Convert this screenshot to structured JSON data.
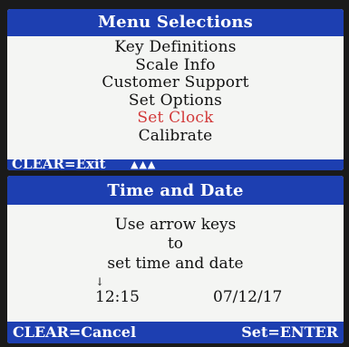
{
  "menu_screen": {
    "title": "Menu Selections",
    "items": [
      {
        "label": "Key Definitions"
      },
      {
        "label": "Scale Info"
      },
      {
        "label": "Customer Support"
      },
      {
        "label": "Set Options"
      },
      {
        "label": "Set Clock",
        "selected": true
      },
      {
        "label": "Calibrate"
      }
    ],
    "selected_color": "#d23a3a",
    "footer_label": "CLEAR=Exit",
    "footer_arrows": "▲▲▲"
  },
  "clock_screen": {
    "title": "Time and Date",
    "instruction_lines": [
      "Use arrow keys",
      "to",
      "set time and date"
    ],
    "cursor_glyph": "↓",
    "time": "12:15",
    "date": "07/12/17",
    "footer_left": "CLEAR=Cancel",
    "footer_right": "Set=ENTER"
  },
  "colors": {
    "bar_blue": "#1d3fb1",
    "screen_bg": "#f4f5f3"
  }
}
